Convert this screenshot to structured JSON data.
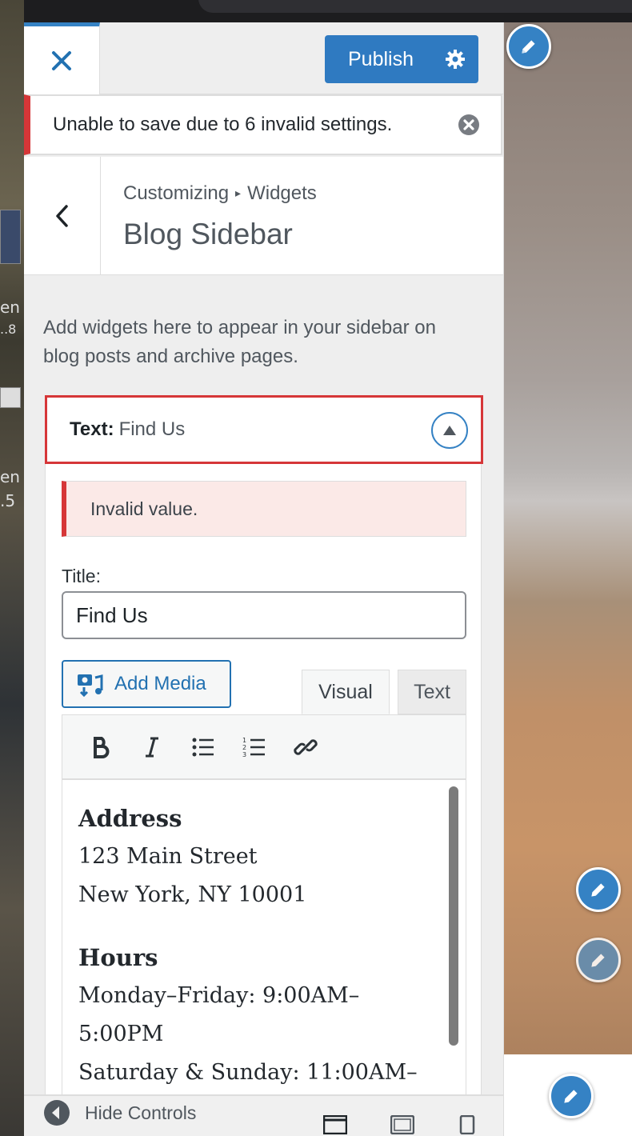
{
  "header": {
    "publish_label": "Publish"
  },
  "notification": {
    "message": "Unable to save due to 6 invalid settings."
  },
  "section": {
    "breadcrumb_parent": "Customizing",
    "breadcrumb_separator": "▸",
    "breadcrumb_current": "Widgets",
    "title": "Blog Sidebar",
    "description": "Add widgets here to appear in your sidebar on blog posts and archive pages."
  },
  "widget": {
    "type_label": "Text:",
    "title": "Find Us",
    "error_message": "Invalid value.",
    "title_field_label": "Title:",
    "title_field_value": "Find Us",
    "add_media_label": "Add Media",
    "tabs": {
      "visual": "Visual",
      "text": "Text"
    },
    "toolbar": [
      "bold-icon",
      "italic-icon",
      "bulleted-list-icon",
      "numbered-list-icon",
      "link-icon"
    ],
    "content": {
      "address_heading": "Address",
      "address_line1": "123 Main Street",
      "address_line2": "New York, NY 10001",
      "hours_heading": "Hours",
      "hours_line1": "Monday–Friday: 9:00AM–",
      "hours_line2": "5:00PM",
      "hours_line3": "Saturday & Sunday: 11:00AM–"
    }
  },
  "footer": {
    "hide_controls_label": "Hide Controls",
    "devices": [
      "desktop-icon",
      "tablet-icon",
      "mobile-icon"
    ]
  },
  "colors": {
    "accent": "#2271b1",
    "publish_bg": "#2f7ac1",
    "error": "#d63638",
    "error_bg": "#fbe9e7"
  }
}
